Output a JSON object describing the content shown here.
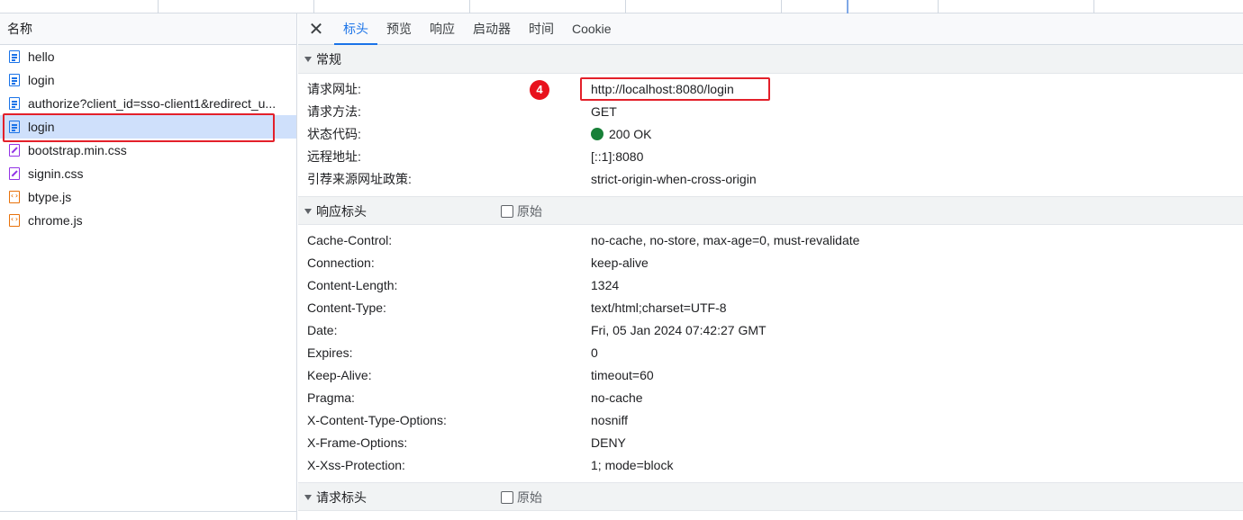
{
  "request_list": {
    "column_title": "名称",
    "items": [
      {
        "name": "hello",
        "type": "doc"
      },
      {
        "name": "login",
        "type": "doc"
      },
      {
        "name": "authorize?client_id=sso-client1&redirect_u...",
        "type": "doc"
      },
      {
        "name": "login",
        "type": "doc"
      },
      {
        "name": "bootstrap.min.css",
        "type": "css"
      },
      {
        "name": "signin.css",
        "type": "css"
      },
      {
        "name": "btype.js",
        "type": "js"
      },
      {
        "name": "chrome.js",
        "type": "js"
      }
    ]
  },
  "tabs": {
    "close": "✕",
    "items": [
      "标头",
      "预览",
      "响应",
      "启动器",
      "时间",
      "Cookie"
    ]
  },
  "general": {
    "title": "常规",
    "annotation": "4",
    "rows": [
      {
        "key": "请求网址:",
        "value": "http://localhost:8080/login"
      },
      {
        "key": "请求方法:",
        "value": "GET"
      },
      {
        "key": "状态代码:",
        "value": "200 OK"
      },
      {
        "key": "远程地址:",
        "value": "[::1]:8080"
      },
      {
        "key": "引荐来源网址政策:",
        "value": "strict-origin-when-cross-origin"
      }
    ]
  },
  "response_headers": {
    "title": "响应标头",
    "raw_label": "原始",
    "rows": [
      {
        "key": "Cache-Control:",
        "value": "no-cache, no-store, max-age=0, must-revalidate"
      },
      {
        "key": "Connection:",
        "value": "keep-alive"
      },
      {
        "key": "Content-Length:",
        "value": "1324"
      },
      {
        "key": "Content-Type:",
        "value": "text/html;charset=UTF-8"
      },
      {
        "key": "Date:",
        "value": "Fri, 05 Jan 2024 07:42:27 GMT"
      },
      {
        "key": "Expires:",
        "value": "0"
      },
      {
        "key": "Keep-Alive:",
        "value": "timeout=60"
      },
      {
        "key": "Pragma:",
        "value": "no-cache"
      },
      {
        "key": "X-Content-Type-Options:",
        "value": "nosniff"
      },
      {
        "key": "X-Frame-Options:",
        "value": "DENY"
      },
      {
        "key": "X-Xss-Protection:",
        "value": "1; mode=block"
      }
    ]
  },
  "request_headers": {
    "title": "请求标头",
    "raw_label": "原始"
  },
  "colors": {
    "accent": "#1a73e8",
    "selected_row": "#cfe0fb",
    "annotation_red": "#e3202a",
    "status_ok": "#188038"
  }
}
